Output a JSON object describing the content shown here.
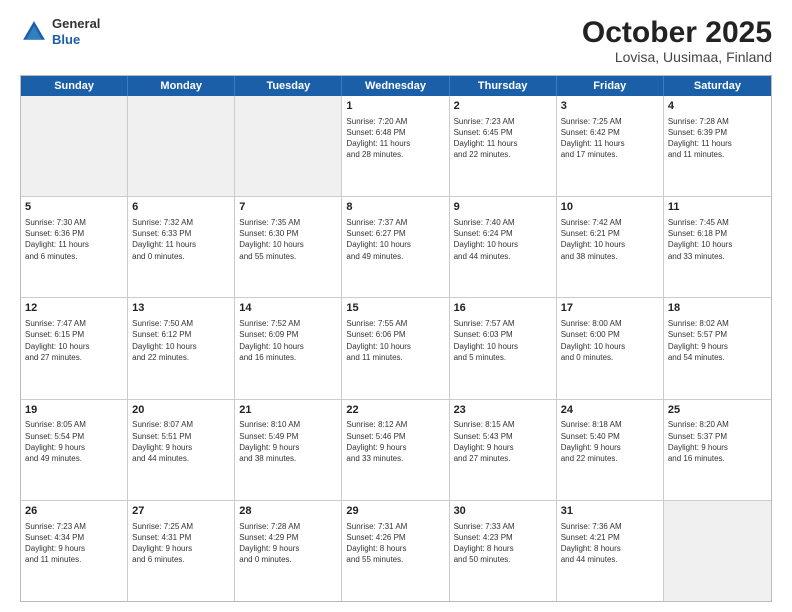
{
  "logo": {
    "general": "General",
    "blue": "Blue"
  },
  "title": "October 2025",
  "subtitle": "Lovisa, Uusimaa, Finland",
  "header_days": [
    "Sunday",
    "Monday",
    "Tuesday",
    "Wednesday",
    "Thursday",
    "Friday",
    "Saturday"
  ],
  "weeks": [
    [
      {
        "day": "",
        "info": "",
        "shaded": true
      },
      {
        "day": "",
        "info": "",
        "shaded": true
      },
      {
        "day": "",
        "info": "",
        "shaded": true
      },
      {
        "day": "1",
        "info": "Sunrise: 7:20 AM\nSunset: 6:48 PM\nDaylight: 11 hours\nand 28 minutes."
      },
      {
        "day": "2",
        "info": "Sunrise: 7:23 AM\nSunset: 6:45 PM\nDaylight: 11 hours\nand 22 minutes."
      },
      {
        "day": "3",
        "info": "Sunrise: 7:25 AM\nSunset: 6:42 PM\nDaylight: 11 hours\nand 17 minutes."
      },
      {
        "day": "4",
        "info": "Sunrise: 7:28 AM\nSunset: 6:39 PM\nDaylight: 11 hours\nand 11 minutes."
      }
    ],
    [
      {
        "day": "5",
        "info": "Sunrise: 7:30 AM\nSunset: 6:36 PM\nDaylight: 11 hours\nand 6 minutes."
      },
      {
        "day": "6",
        "info": "Sunrise: 7:32 AM\nSunset: 6:33 PM\nDaylight: 11 hours\nand 0 minutes."
      },
      {
        "day": "7",
        "info": "Sunrise: 7:35 AM\nSunset: 6:30 PM\nDaylight: 10 hours\nand 55 minutes."
      },
      {
        "day": "8",
        "info": "Sunrise: 7:37 AM\nSunset: 6:27 PM\nDaylight: 10 hours\nand 49 minutes."
      },
      {
        "day": "9",
        "info": "Sunrise: 7:40 AM\nSunset: 6:24 PM\nDaylight: 10 hours\nand 44 minutes."
      },
      {
        "day": "10",
        "info": "Sunrise: 7:42 AM\nSunset: 6:21 PM\nDaylight: 10 hours\nand 38 minutes."
      },
      {
        "day": "11",
        "info": "Sunrise: 7:45 AM\nSunset: 6:18 PM\nDaylight: 10 hours\nand 33 minutes."
      }
    ],
    [
      {
        "day": "12",
        "info": "Sunrise: 7:47 AM\nSunset: 6:15 PM\nDaylight: 10 hours\nand 27 minutes."
      },
      {
        "day": "13",
        "info": "Sunrise: 7:50 AM\nSunset: 6:12 PM\nDaylight: 10 hours\nand 22 minutes."
      },
      {
        "day": "14",
        "info": "Sunrise: 7:52 AM\nSunset: 6:09 PM\nDaylight: 10 hours\nand 16 minutes."
      },
      {
        "day": "15",
        "info": "Sunrise: 7:55 AM\nSunset: 6:06 PM\nDaylight: 10 hours\nand 11 minutes."
      },
      {
        "day": "16",
        "info": "Sunrise: 7:57 AM\nSunset: 6:03 PM\nDaylight: 10 hours\nand 5 minutes."
      },
      {
        "day": "17",
        "info": "Sunrise: 8:00 AM\nSunset: 6:00 PM\nDaylight: 10 hours\nand 0 minutes."
      },
      {
        "day": "18",
        "info": "Sunrise: 8:02 AM\nSunset: 5:57 PM\nDaylight: 9 hours\nand 54 minutes."
      }
    ],
    [
      {
        "day": "19",
        "info": "Sunrise: 8:05 AM\nSunset: 5:54 PM\nDaylight: 9 hours\nand 49 minutes."
      },
      {
        "day": "20",
        "info": "Sunrise: 8:07 AM\nSunset: 5:51 PM\nDaylight: 9 hours\nand 44 minutes."
      },
      {
        "day": "21",
        "info": "Sunrise: 8:10 AM\nSunset: 5:49 PM\nDaylight: 9 hours\nand 38 minutes."
      },
      {
        "day": "22",
        "info": "Sunrise: 8:12 AM\nSunset: 5:46 PM\nDaylight: 9 hours\nand 33 minutes."
      },
      {
        "day": "23",
        "info": "Sunrise: 8:15 AM\nSunset: 5:43 PM\nDaylight: 9 hours\nand 27 minutes."
      },
      {
        "day": "24",
        "info": "Sunrise: 8:18 AM\nSunset: 5:40 PM\nDaylight: 9 hours\nand 22 minutes."
      },
      {
        "day": "25",
        "info": "Sunrise: 8:20 AM\nSunset: 5:37 PM\nDaylight: 9 hours\nand 16 minutes."
      }
    ],
    [
      {
        "day": "26",
        "info": "Sunrise: 7:23 AM\nSunset: 4:34 PM\nDaylight: 9 hours\nand 11 minutes."
      },
      {
        "day": "27",
        "info": "Sunrise: 7:25 AM\nSunset: 4:31 PM\nDaylight: 9 hours\nand 6 minutes."
      },
      {
        "day": "28",
        "info": "Sunrise: 7:28 AM\nSunset: 4:29 PM\nDaylight: 9 hours\nand 0 minutes."
      },
      {
        "day": "29",
        "info": "Sunrise: 7:31 AM\nSunset: 4:26 PM\nDaylight: 8 hours\nand 55 minutes."
      },
      {
        "day": "30",
        "info": "Sunrise: 7:33 AM\nSunset: 4:23 PM\nDaylight: 8 hours\nand 50 minutes."
      },
      {
        "day": "31",
        "info": "Sunrise: 7:36 AM\nSunset: 4:21 PM\nDaylight: 8 hours\nand 44 minutes."
      },
      {
        "day": "",
        "info": "",
        "shaded": true
      }
    ]
  ]
}
